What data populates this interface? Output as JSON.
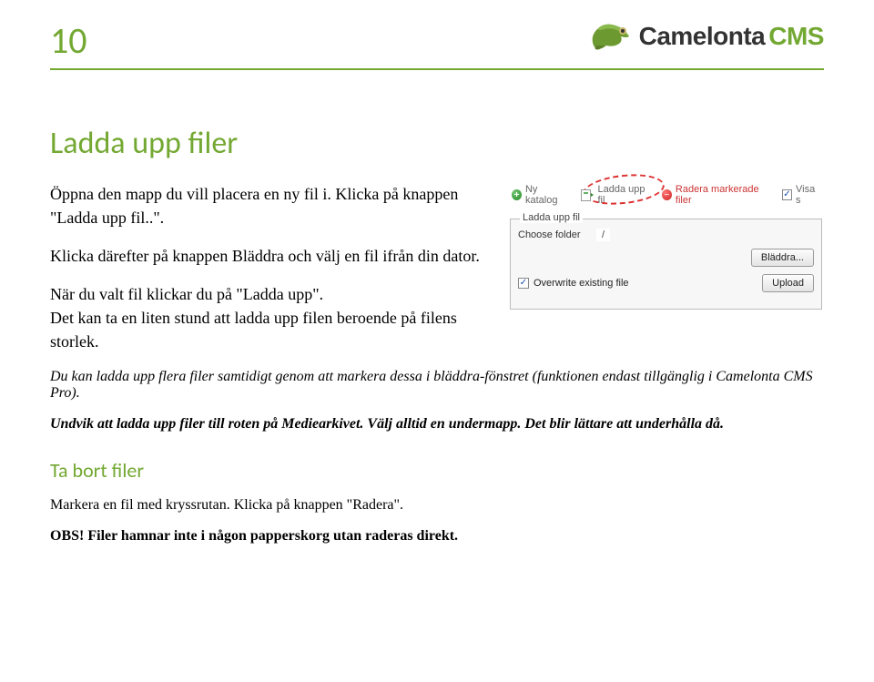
{
  "page_number": "10",
  "brand": {
    "name1": "Camelonta",
    "name2": "CMS"
  },
  "section1_title": "Ladda upp filer",
  "para1": "Öppna den mapp du vill placera en ny fil i. Klicka på knappen \"Ladda upp fil..\".",
  "para2": "Klicka därefter på knappen Bläddra och välj en fil ifrån din dator.",
  "para3_a": "När du valt fil klickar du på \"Ladda upp\".",
  "para3_b": "Det kan ta en liten stund att ladda upp filen beroende på filens storlek.",
  "para4_a": "Du kan ladda upp flera filer samtidigt genom att markera dessa i bläddra-fönstret ",
  "para4_b": "(funktionen endast tillgänglig i Camelonta CMS Pro).",
  "para5": "Undvik att ladda upp filer till roten på Mediearkivet. Välj alltid en undermapp. Det blir lättare att underhålla då.",
  "section2_title": "Ta bort filer",
  "para6": "Markera en fil med kryssrutan. Klicka på knappen \"Radera\".",
  "obs_label": "OBS! ",
  "obs_text": "Filer hamnar inte i någon papperskorg utan raderas direkt.",
  "shot": {
    "toolbar": {
      "new_folder": "Ny katalog",
      "upload_file": "Ladda upp fil",
      "delete_marked": "Radera markerade filer",
      "visa": "Visa s"
    },
    "panel": {
      "legend": "Ladda upp fil",
      "choose_folder_label": "Choose folder",
      "choose_folder_value": "/",
      "browse_btn": "Bläddra...",
      "overwrite_label": "Overwrite existing file",
      "upload_btn": "Upload"
    }
  }
}
